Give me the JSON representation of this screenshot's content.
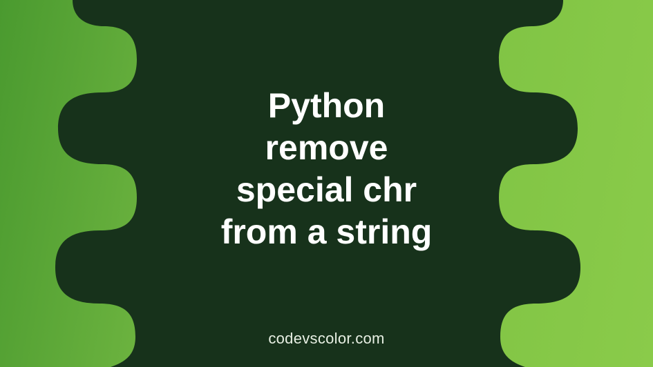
{
  "banner": {
    "title_lines": "Python\nremove\nspecial chr\nfrom a string",
    "credit": "codevscolor.com"
  },
  "colors": {
    "blob": "#17321b",
    "text": "#ffffff",
    "credit": "#e8f0e4",
    "bg_left": "#4a9a2f",
    "bg_right": "#8acb4a"
  }
}
